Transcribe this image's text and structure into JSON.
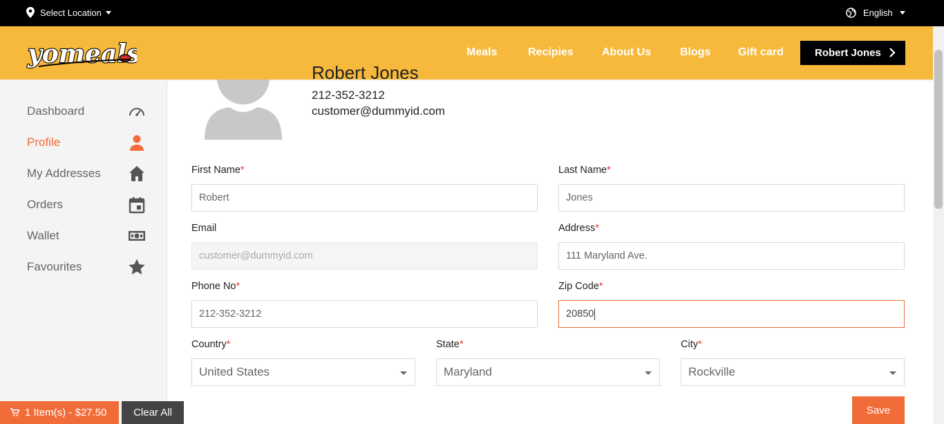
{
  "topbar": {
    "location_label": "Select Location",
    "language_label": "English"
  },
  "header": {
    "logo_text": "yomeals",
    "nav": [
      "Meals",
      "Recipies",
      "About Us",
      "Blogs",
      "Gift card"
    ],
    "user_button": "Robert Jones"
  },
  "sidebar": {
    "items": [
      {
        "label": "Dashboard",
        "icon": "speedometer-icon"
      },
      {
        "label": "Profile",
        "icon": "person-icon"
      },
      {
        "label": "My Addresses",
        "icon": "home-icon"
      },
      {
        "label": "Orders",
        "icon": "calendar-icon"
      },
      {
        "label": "Wallet",
        "icon": "money-icon"
      },
      {
        "label": "Favourites",
        "icon": "star-icon"
      }
    ],
    "active_index": 1
  },
  "profile": {
    "name": "Robert Jones",
    "phone": "212-352-3212",
    "email": "customer@dummyid.com"
  },
  "form": {
    "first_name": {
      "label": "First Name",
      "required": "*",
      "value": "Robert"
    },
    "last_name": {
      "label": "Last Name",
      "required": "*",
      "value": "Jones"
    },
    "email": {
      "label": "Email",
      "value": "customer@dummyid.com"
    },
    "address": {
      "label": "Address",
      "required": "*",
      "value": "111 Maryland Ave."
    },
    "phone": {
      "label": "Phone No",
      "required": "*",
      "value": "212-352-3212"
    },
    "zip": {
      "label": "Zip Code",
      "required": "*",
      "value": "20850"
    },
    "country": {
      "label": "Country",
      "required": "*",
      "value": "United States"
    },
    "state": {
      "label": "State",
      "required": "*",
      "value": "Maryland"
    },
    "city": {
      "label": "City",
      "required": "*",
      "value": "Rockville"
    },
    "save_label": "Save"
  },
  "cart": {
    "summary": "1 Item(s) - $27.50",
    "clear_label": "Clear All"
  },
  "colors": {
    "accent": "#f26c3a",
    "header_bg": "#f6b93b",
    "topbar_bg": "#000000"
  }
}
